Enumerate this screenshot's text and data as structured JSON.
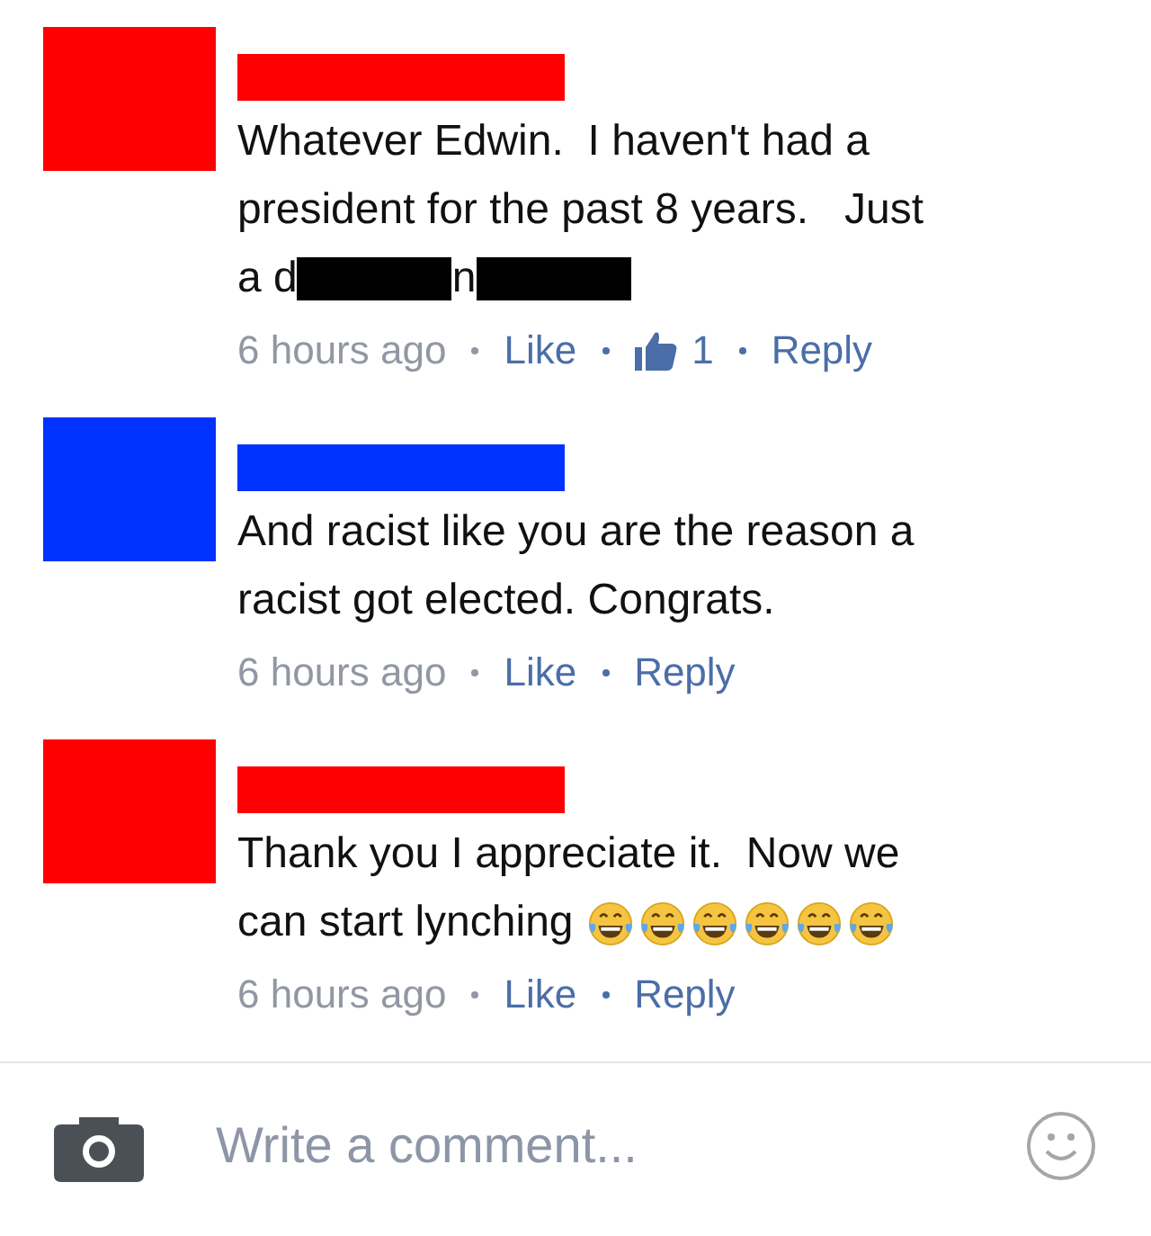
{
  "comments": [
    {
      "avatar": {
        "color": "#ff0000"
      },
      "name": {
        "color": "#ff0000"
      },
      "lines": [
        [
          {
            "kind": "text",
            "text": "Whatever Edwin.  I haven't had a"
          }
        ],
        [
          {
            "kind": "text",
            "text": "president for the past 8 years.   Just"
          }
        ],
        [
          {
            "kind": "text",
            "text": "a d"
          },
          {
            "kind": "redacted",
            "color": "#000000"
          },
          {
            "kind": "text",
            "text": "n"
          },
          {
            "kind": "redacted",
            "color": "#000000"
          }
        ]
      ],
      "time": "6 hours ago",
      "like": "Like",
      "likes": "1",
      "reply": "Reply"
    },
    {
      "avatar": {
        "color": "#0033ff"
      },
      "name": {
        "color": "#0033ff"
      },
      "lines": [
        [
          {
            "kind": "text",
            "text": "And racist like you are the reason a"
          }
        ],
        [
          {
            "kind": "text",
            "text": "racist got elected. Congrats."
          }
        ]
      ],
      "time": "6 hours ago",
      "like": "Like",
      "reply": "Reply"
    },
    {
      "avatar": {
        "color": "#ff0000"
      },
      "name": {
        "color": "#ff0000"
      },
      "lines": [
        [
          {
            "kind": "text",
            "text": "Thank you I appreciate it.  Now we"
          }
        ],
        [
          {
            "kind": "text",
            "text": "can start lynching "
          },
          {
            "kind": "emoji"
          },
          {
            "kind": "emoji"
          },
          {
            "kind": "emoji"
          },
          {
            "kind": "emoji"
          },
          {
            "kind": "emoji"
          },
          {
            "kind": "emoji"
          }
        ]
      ],
      "time": "6 hours ago",
      "like": "Like",
      "reply": "Reply"
    }
  ],
  "composer": {
    "placeholder": "Write a comment..."
  }
}
